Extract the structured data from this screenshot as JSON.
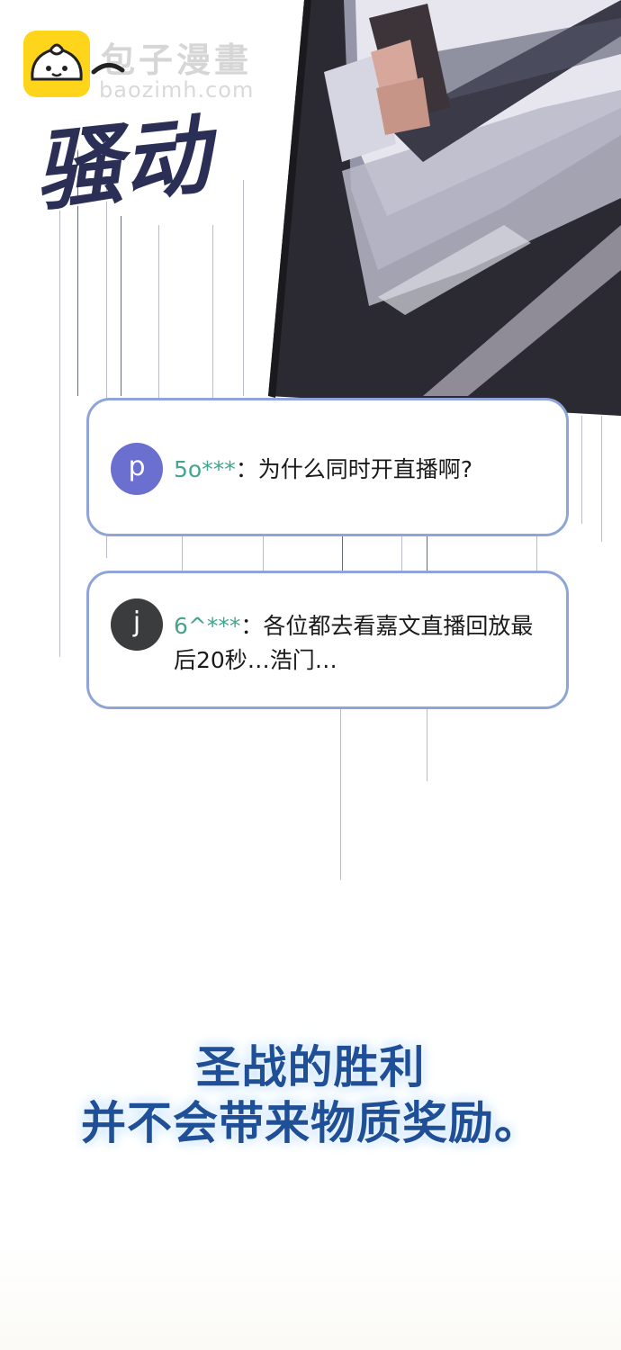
{
  "watermark": {
    "site_name": "包子漫畫",
    "site_url": "baozimh.com"
  },
  "sound_effect": "骚动",
  "chat": [
    {
      "avatar_letter": "p",
      "avatar_color": "#6a6fd0",
      "username": "5o***",
      "separator": "：",
      "text": "为什么同时开直播啊?"
    },
    {
      "avatar_letter": "j",
      "avatar_color": "#3a3c3e",
      "username": "6^***",
      "separator": "：",
      "text": "各位都去看嘉文直播回放最后20秒…浩门…"
    }
  ],
  "caption": {
    "line1": "圣战的胜利",
    "line2": "并不会带来物质奖励。",
    "color": "#1f4f97"
  },
  "colors": {
    "bubble_border": "#8fa4d8",
    "username": "#45a38e",
    "logo": "#ffd51c"
  }
}
